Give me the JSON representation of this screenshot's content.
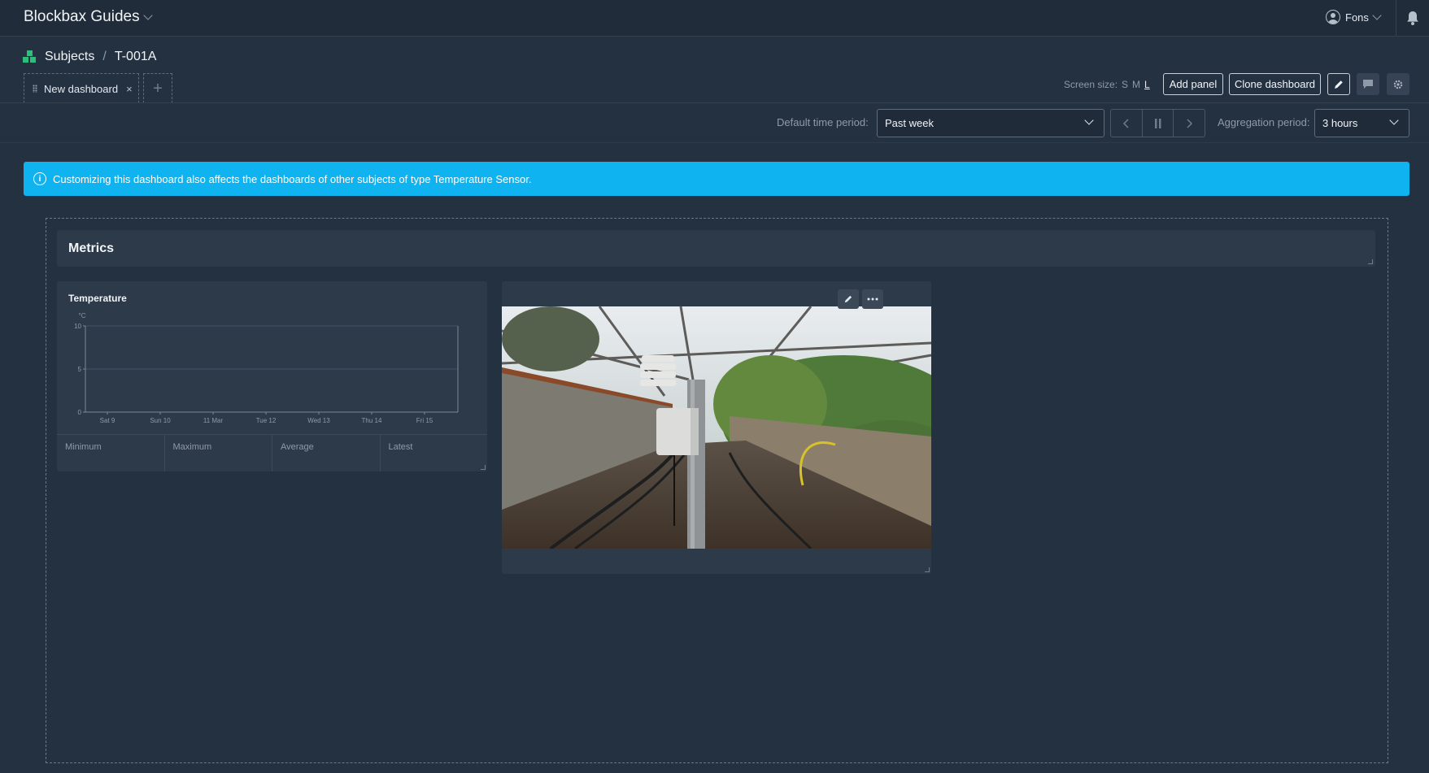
{
  "app": {
    "title": "Blockbax Guides"
  },
  "user": {
    "name": "Fons"
  },
  "breadcrumb": {
    "root": "Subjects",
    "separator": "/",
    "current": "T-001A"
  },
  "tabs": [
    {
      "label": "New dashboard",
      "close": "×"
    }
  ],
  "add_tab": "+",
  "toolbar": {
    "screen_size_label": "Screen size:",
    "sizes": [
      "S",
      "M",
      "L"
    ],
    "active_size": "L",
    "add_panel": "Add panel",
    "clone_dashboard": "Clone dashboard"
  },
  "time": {
    "default_period_label": "Default time period:",
    "default_period_value": "Past week",
    "aggregation_label": "Aggregation period:",
    "aggregation_value": "3 hours"
  },
  "banner": {
    "text": "Customizing this dashboard also affects the dashboards of other subjects of type Temperature Sensor."
  },
  "section": {
    "title": "Metrics"
  },
  "temperature_panel": {
    "title": "Temperature",
    "stats": [
      "Minimum",
      "Maximum",
      "Average",
      "Latest"
    ]
  },
  "chart_data": {
    "type": "line",
    "title": "Temperature",
    "ylabel": "°C",
    "ylim": [
      0,
      10
    ],
    "yticks": [
      "0",
      "5",
      "10"
    ],
    "categories": [
      "Sat 9",
      "Sun 10",
      "11 Mar",
      "Tue 12",
      "Wed 13",
      "Thu 14",
      "Fri 15"
    ],
    "series": []
  },
  "image_panel": {
    "alt": "Temperature sensor in greenhouse"
  },
  "icons": {
    "user": "user-circle-icon",
    "bell": "bell-icon",
    "edit": "pencil-icon",
    "comment": "comment-icon",
    "settings": "gear-icon",
    "more": "ellipsis-icon",
    "info": "info-icon"
  }
}
